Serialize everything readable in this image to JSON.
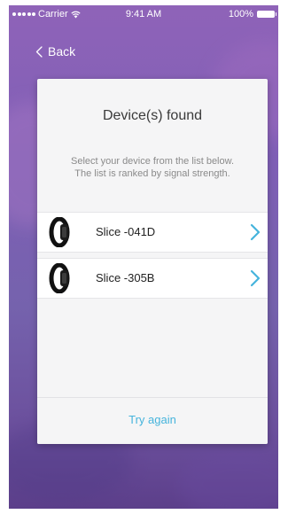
{
  "status_bar": {
    "carrier": "Carrier",
    "time": "9:41 AM",
    "battery": "100%"
  },
  "nav": {
    "back_label": "Back"
  },
  "card": {
    "title": "Device(s) found",
    "description": "Select your device from the list below. The list is ranked by signal strength.",
    "devices": [
      {
        "name": "Slice -041D",
        "icon": "fitness-band-icon"
      },
      {
        "name": "Slice -305B",
        "icon": "fitness-band-icon"
      }
    ],
    "footer_button": "Try again"
  },
  "colors": {
    "accent": "#46b4dc",
    "background_top": "#8f63b8",
    "background_bottom": "#5c3f8a"
  }
}
